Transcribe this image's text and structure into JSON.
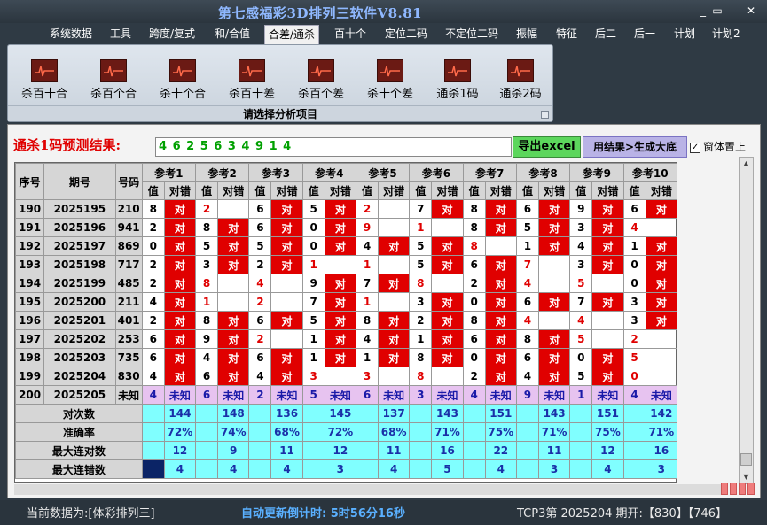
{
  "window": {
    "title": "第七感福彩3D排列三软件V8.81",
    "min": "_",
    "restore": "▭",
    "close": "✕"
  },
  "menu": [
    "系统数据",
    "工具",
    "跨度/复式",
    "和/合值",
    "合差/通杀",
    "百十个",
    "定位二码",
    "不定位二码",
    "振幅",
    "特征",
    "后二",
    "后一",
    "计划",
    "计划2"
  ],
  "ribbon": {
    "buttons": [
      "杀百十合",
      "杀百个合",
      "杀十个合",
      "杀百十差",
      "杀百个差",
      "杀十个差",
      "通杀1码",
      "通杀2码"
    ],
    "footer": "请选择分析项目"
  },
  "prediction": {
    "label": "通杀1码预测结果:",
    "value": "4 6 2 5 6 3 4 9 1 4",
    "excel_button": "导出excel",
    "generate_button": "用结果>生成大底",
    "topmost_label": "窗体置上",
    "topmost_checked": "✓"
  },
  "table": {
    "h_seq": "序号",
    "h_issue": "期号",
    "h_number": "号码",
    "refs": [
      "参考1",
      "参考2",
      "参考3",
      "参考4",
      "参考5",
      "参考6",
      "参考7",
      "参考8",
      "参考9",
      "参考10"
    ],
    "sub_value": "值",
    "sub_result": "对错",
    "rows": [
      {
        "seq": "190",
        "issue": "2025195",
        "num": "210",
        "vals": [
          [
            "8",
            "对"
          ],
          [
            "2",
            ""
          ],
          [
            "6",
            "对"
          ],
          [
            "5",
            "对"
          ],
          [
            "2",
            ""
          ],
          [
            "7",
            "对"
          ],
          [
            "8",
            "对"
          ],
          [
            "6",
            "对"
          ],
          [
            "9",
            "对"
          ],
          [
            "6",
            "对"
          ]
        ]
      },
      {
        "seq": "191",
        "issue": "2025196",
        "num": "941",
        "vals": [
          [
            "2",
            "对"
          ],
          [
            "8",
            "对"
          ],
          [
            "6",
            "对"
          ],
          [
            "0",
            "对"
          ],
          [
            "9",
            ""
          ],
          [
            "1",
            ""
          ],
          [
            "8",
            "对"
          ],
          [
            "5",
            "对"
          ],
          [
            "3",
            "对"
          ],
          [
            "4",
            ""
          ]
        ]
      },
      {
        "seq": "192",
        "issue": "2025197",
        "num": "869",
        "vals": [
          [
            "0",
            "对"
          ],
          [
            "5",
            "对"
          ],
          [
            "5",
            "对"
          ],
          [
            "0",
            "对"
          ],
          [
            "4",
            "对"
          ],
          [
            "5",
            "对"
          ],
          [
            "8",
            ""
          ],
          [
            "1",
            "对"
          ],
          [
            "4",
            "对"
          ],
          [
            "1",
            "对"
          ]
        ]
      },
      {
        "seq": "193",
        "issue": "2025198",
        "num": "717",
        "vals": [
          [
            "2",
            "对"
          ],
          [
            "3",
            "对"
          ],
          [
            "2",
            "对"
          ],
          [
            "1",
            ""
          ],
          [
            "1",
            ""
          ],
          [
            "5",
            "对"
          ],
          [
            "6",
            "对"
          ],
          [
            "7",
            ""
          ],
          [
            "3",
            "对"
          ],
          [
            "0",
            "对"
          ]
        ]
      },
      {
        "seq": "194",
        "issue": "2025199",
        "num": "485",
        "vals": [
          [
            "2",
            "对"
          ],
          [
            "8",
            ""
          ],
          [
            "4",
            ""
          ],
          [
            "9",
            "对"
          ],
          [
            "7",
            "对"
          ],
          [
            "8",
            ""
          ],
          [
            "2",
            "对"
          ],
          [
            "4",
            ""
          ],
          [
            "5",
            ""
          ],
          [
            "0",
            "对"
          ]
        ]
      },
      {
        "seq": "195",
        "issue": "2025200",
        "num": "211",
        "vals": [
          [
            "4",
            "对"
          ],
          [
            "1",
            ""
          ],
          [
            "2",
            ""
          ],
          [
            "7",
            "对"
          ],
          [
            "1",
            ""
          ],
          [
            "3",
            "对"
          ],
          [
            "0",
            "对"
          ],
          [
            "6",
            "对"
          ],
          [
            "7",
            "对"
          ],
          [
            "3",
            "对"
          ]
        ]
      },
      {
        "seq": "196",
        "issue": "2025201",
        "num": "401",
        "vals": [
          [
            "2",
            "对"
          ],
          [
            "8",
            "对"
          ],
          [
            "6",
            "对"
          ],
          [
            "5",
            "对"
          ],
          [
            "8",
            "对"
          ],
          [
            "2",
            "对"
          ],
          [
            "8",
            "对"
          ],
          [
            "4",
            ""
          ],
          [
            "4",
            ""
          ],
          [
            "3",
            "对"
          ]
        ]
      },
      {
        "seq": "197",
        "issue": "2025202",
        "num": "253",
        "vals": [
          [
            "6",
            "对"
          ],
          [
            "9",
            "对"
          ],
          [
            "2",
            ""
          ],
          [
            "1",
            "对"
          ],
          [
            "4",
            "对"
          ],
          [
            "1",
            "对"
          ],
          [
            "6",
            "对"
          ],
          [
            "8",
            "对"
          ],
          [
            "5",
            ""
          ],
          [
            "2",
            ""
          ]
        ]
      },
      {
        "seq": "198",
        "issue": "2025203",
        "num": "735",
        "vals": [
          [
            "6",
            "对"
          ],
          [
            "4",
            "对"
          ],
          [
            "6",
            "对"
          ],
          [
            "1",
            "对"
          ],
          [
            "1",
            "对"
          ],
          [
            "8",
            "对"
          ],
          [
            "0",
            "对"
          ],
          [
            "6",
            "对"
          ],
          [
            "0",
            "对"
          ],
          [
            "5",
            ""
          ]
        ]
      },
      {
        "seq": "199",
        "issue": "2025204",
        "num": "830",
        "vals": [
          [
            "4",
            "对"
          ],
          [
            "6",
            "对"
          ],
          [
            "4",
            "对"
          ],
          [
            "3",
            ""
          ],
          [
            "3",
            ""
          ],
          [
            "8",
            ""
          ],
          [
            "2",
            "对"
          ],
          [
            "4",
            "对"
          ],
          [
            "5",
            "对"
          ],
          [
            "0",
            ""
          ]
        ]
      }
    ],
    "pending": {
      "seq": "200",
      "issue": "2025205",
      "num": "未知",
      "vals": [
        "4",
        "6",
        "2",
        "5",
        "6",
        "3",
        "4",
        "9",
        "1",
        "4"
      ],
      "result": "未知"
    },
    "summary": [
      {
        "label": "对次数",
        "vals": [
          "144",
          "148",
          "136",
          "145",
          "137",
          "143",
          "151",
          "143",
          "151",
          "142"
        ]
      },
      {
        "label": "准确率",
        "vals": [
          "72%",
          "74%",
          "68%",
          "72%",
          "68%",
          "71%",
          "75%",
          "71%",
          "75%",
          "71%"
        ]
      },
      {
        "label": "最大连对数",
        "vals": [
          "12",
          "9",
          "11",
          "12",
          "11",
          "16",
          "22",
          "11",
          "12",
          "16"
        ]
      },
      {
        "label": "最大连错数",
        "vals": [
          "4",
          "4",
          "4",
          "3",
          "4",
          "5",
          "4",
          "3",
          "4",
          "3"
        ]
      }
    ]
  },
  "status": {
    "current": "当前数据为:[体彩排列三]",
    "countdown": "自动更新倒计时:  5时56分16秒",
    "draw": "TCP3第 2025204 期开:【830】【746】"
  },
  "colors": {
    "error_red": "#e00000",
    "summary_cyan": "#80ffff",
    "pending_purple": "#e7c3f0",
    "header_grey": "#d6d6d6"
  },
  "icons": [
    "chart-icon",
    "minimize-icon",
    "restore-icon",
    "close-icon",
    "checkbox-icon",
    "scroll-up-icon",
    "scroll-down-icon"
  ]
}
